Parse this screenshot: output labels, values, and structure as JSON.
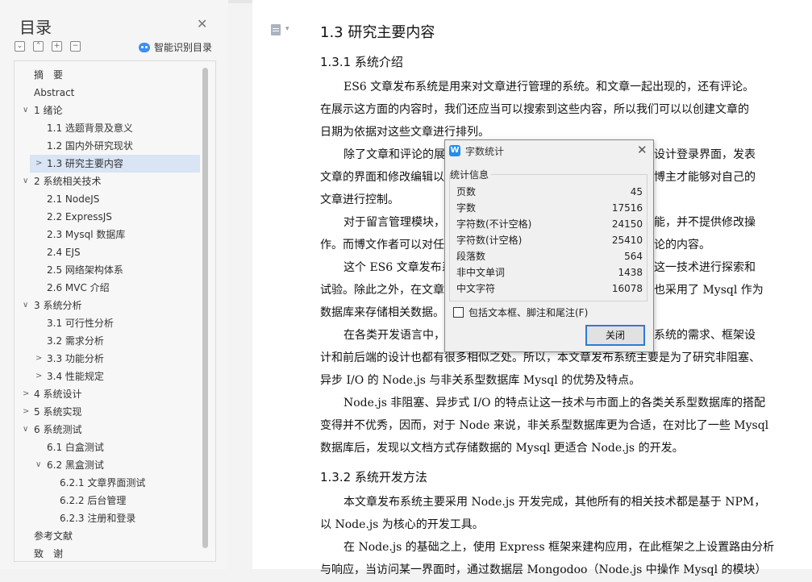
{
  "toc": {
    "title": "目录",
    "smart_label": "智能识别目录",
    "items": [
      {
        "label": "摘　要",
        "level": 1,
        "chevron": ""
      },
      {
        "label": "Abstract",
        "level": 1,
        "chevron": ""
      },
      {
        "label": "1 绪论",
        "level": 1,
        "chevron": "∨"
      },
      {
        "label": "1.1 选题背景及意义",
        "level": 2,
        "chevron": ""
      },
      {
        "label": "1.2 国内外研究现状",
        "level": 2,
        "chevron": ""
      },
      {
        "label": "1.3 研究主要内容",
        "level": 2,
        "chevron": ">",
        "selected": true
      },
      {
        "label": "2 系统相关技术",
        "level": 1,
        "chevron": "∨"
      },
      {
        "label": "2.1 NodeJS",
        "level": 2,
        "chevron": ""
      },
      {
        "label": "2.2 ExpressJS",
        "level": 2,
        "chevron": ""
      },
      {
        "label": "2.3 Mysql 数据库",
        "level": 2,
        "chevron": ""
      },
      {
        "label": "2.4 EJS",
        "level": 2,
        "chevron": ""
      },
      {
        "label": "2.5 网络架构体系",
        "level": 2,
        "chevron": ""
      },
      {
        "label": "2.6 MVC 介绍",
        "level": 2,
        "chevron": ""
      },
      {
        "label": "3 系统分析",
        "level": 1,
        "chevron": "∨"
      },
      {
        "label": "3.1 可行性分析",
        "level": 2,
        "chevron": ""
      },
      {
        "label": "3.2 需求分析",
        "level": 2,
        "chevron": ""
      },
      {
        "label": "3.3 功能分析",
        "level": 2,
        "chevron": ">"
      },
      {
        "label": "3.4 性能规定",
        "level": 2,
        "chevron": ">"
      },
      {
        "label": "4 系统设计",
        "level": 1,
        "chevron": ">"
      },
      {
        "label": "5 系统实现",
        "level": 1,
        "chevron": ">"
      },
      {
        "label": "6 系统测试",
        "level": 1,
        "chevron": "∨"
      },
      {
        "label": "6.1 白盒测试",
        "level": 2,
        "chevron": ""
      },
      {
        "label": "6.2 黑盒测试",
        "level": 2,
        "chevron": "∨"
      },
      {
        "label": "6.2.1 文章界面测试",
        "level": 3,
        "chevron": ""
      },
      {
        "label": "6.2.2 后台管理",
        "level": 3,
        "chevron": ""
      },
      {
        "label": "6.2.3 注册和登录",
        "level": 3,
        "chevron": ""
      },
      {
        "label": "参考文献",
        "level": 1,
        "chevron": ""
      },
      {
        "label": "致　谢",
        "level": 1,
        "chevron": ""
      }
    ]
  },
  "doc": {
    "h2": "1.3 研究主要内容",
    "h3a": "1.3.1 系统介绍",
    "h3b": "1.3.2 系统开发方法",
    "lines": [
      "ES6 文章发布系统是用来对文章进行管理的系统。和文章一起出现的，还有评论。",
      "在展示这方面的内容时，我们还应当可以搜索到这些内容，所以我们可以以创建文章的",
      "日期为依据对这些文章进行排列。",
      "除了文章和评论的展",
      "设计登录界面，发表",
      "文章的界面和修改编辑以",
      "博主才能够对自己的",
      "文章进行控制。",
      "对于留言管理模块，",
      "能，并不提供修改操",
      "作。而博文作者可以对任",
      "论的内容。",
      "这个 ES6 文章发布系",
      "这一技术进行探索和",
      "试验。除此之外，在文章",
      "也采用了 Mysql 作为",
      "数据库来存储相关数据。",
      "在各类开发语言中，",
      "系统的需求、框架设",
      "计和前后端的设计也都有很多相似之处。所以，本文章发布系统主要是为了研究非阻塞、",
      "异步 I/O 的 Node.js 与非关系型数据库 Mysql 的优势及特点。",
      "Node.js 非阻塞、异步式 I/O 的特点让这一技术与市面上的各类关系型数据库的搭配",
      "变得并不优秀，因而，对于 Node 来说，非关系型数据库更为合适，在对比了一些 Mysql",
      "数据库后，发现以文档方式存储数据的 Mysql 更适合 Node.js 的开发。",
      "本文章发布系统主要采用 Node.js 开发完成，其他所有的相关技术都是基于 NPM，",
      "以 Node.js 为核心的开发工具。",
      "在 Node.js 的基础之上，使用 Express 框架来建构应用，在此框架之上设置路由分析",
      "与响应，当访问某一界面时，通过数据层 Mongodoo（Node.js 中操作 Mysql 的模块）"
    ]
  },
  "dialog": {
    "title": "字数统计",
    "logo_text": "W",
    "group_label": "统计信息",
    "stats": [
      {
        "label": "页数",
        "value": "45"
      },
      {
        "label": "字数",
        "value": "17516"
      },
      {
        "label": "字符数(不计空格)",
        "value": "24150"
      },
      {
        "label": "字符数(计空格)",
        "value": "25410"
      },
      {
        "label": "段落数",
        "value": "564"
      },
      {
        "label": "非中文单词",
        "value": "1438"
      },
      {
        "label": "中文字符",
        "value": "16078"
      }
    ],
    "checkbox_label": "包括文本框、脚注和尾注(F)",
    "close_label": "关闭"
  }
}
